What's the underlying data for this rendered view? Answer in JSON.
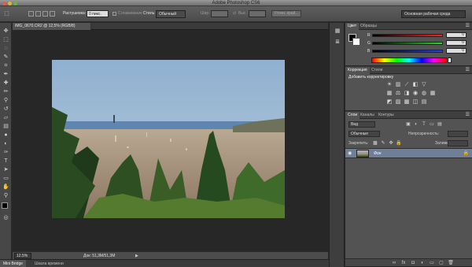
{
  "window": {
    "title": "Adobe Photoshop CS6"
  },
  "options": {
    "feather_label": "Растушевка:",
    "feather_value": "0 пикс.",
    "antialias_label": "Сглаживание",
    "style_label": "Стиль:",
    "style_value": "Обычный",
    "width_label": "Шир.:",
    "height_label": "Выс.:",
    "refine_edge_label": "Уточн. край...",
    "workspace_value": "Основная рабочая среда"
  },
  "document": {
    "tab_label": "IMG_0670.CR2 @ 12,5% (RGB/8)",
    "zoom": "12.5%",
    "doc_size": "Док: 51,3M/51,3M"
  },
  "bottom_tabs": [
    "Mini Bridge",
    "Шкала времени"
  ],
  "color_panel": {
    "tabs": [
      "Цвет",
      "Образцы"
    ],
    "sliders": [
      {
        "label": "R",
        "value": "0",
        "color": "#e0403a"
      },
      {
        "label": "G",
        "value": "0",
        "color": "#3fb24a"
      },
      {
        "label": "B",
        "value": "0",
        "color": "#3a5ae0"
      }
    ]
  },
  "adjustments_panel": {
    "tabs": [
      "Коррекция",
      "Стили"
    ],
    "heading": "Добавить корректировку"
  },
  "layers_panel": {
    "tabs": [
      "Слои",
      "Каналы",
      "Контуры"
    ],
    "kind_value": "Вид",
    "blend_mode": "Обычные",
    "opacity_label": "Непрозрачность:",
    "lock_label": "Закрепить:",
    "fill_label": "Заливка:",
    "layer_name": "Фон"
  },
  "colors": {
    "accent_layer": "#6f7f97",
    "panel_bg": "#535353",
    "workspace_bg": "#272727"
  }
}
